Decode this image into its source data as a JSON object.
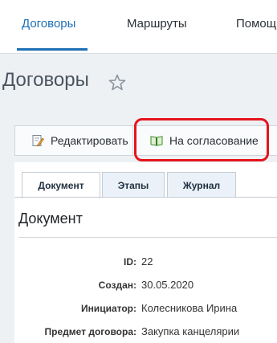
{
  "nav": {
    "items": [
      "Договоры",
      "Маршруты",
      "Помощь"
    ],
    "active": "Договоры"
  },
  "page": {
    "title": "Договоры"
  },
  "toolbar": {
    "edit_label": "Редактировать",
    "approve_label": "На согласование"
  },
  "tabs": [
    "Документ",
    "Этапы",
    "Журнал"
  ],
  "document": {
    "title": "Документ",
    "fields": [
      {
        "label": "ID:",
        "value": "22"
      },
      {
        "label": "Создан:",
        "value": "30.05.2020"
      },
      {
        "label": "Инициатор:",
        "value": "Колесникова Ирина"
      },
      {
        "label": "Предмет договора:",
        "value": "Закупка канцелярии"
      }
    ]
  },
  "colors": {
    "accent": "#1e6fb5",
    "highlight": "#e5141c"
  },
  "icons": {
    "favorite": "star-outline-icon",
    "edit": "edit-document-icon",
    "approve": "book-icon"
  }
}
